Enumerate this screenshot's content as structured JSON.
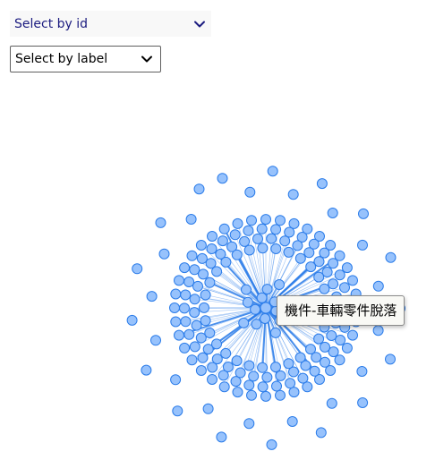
{
  "controls": {
    "select_by_id": {
      "selected": "Select by id"
    },
    "select_by_label": {
      "selected": "Select by label"
    }
  },
  "graph": {
    "node_fill": "#97c2fc",
    "node_stroke": "#2b7ce9",
    "edge_color": "#2b7ce9",
    "tooltip_text": "機件-車輛零件脫落"
  },
  "icons": {
    "dropdown": "chevron-down-icon"
  }
}
